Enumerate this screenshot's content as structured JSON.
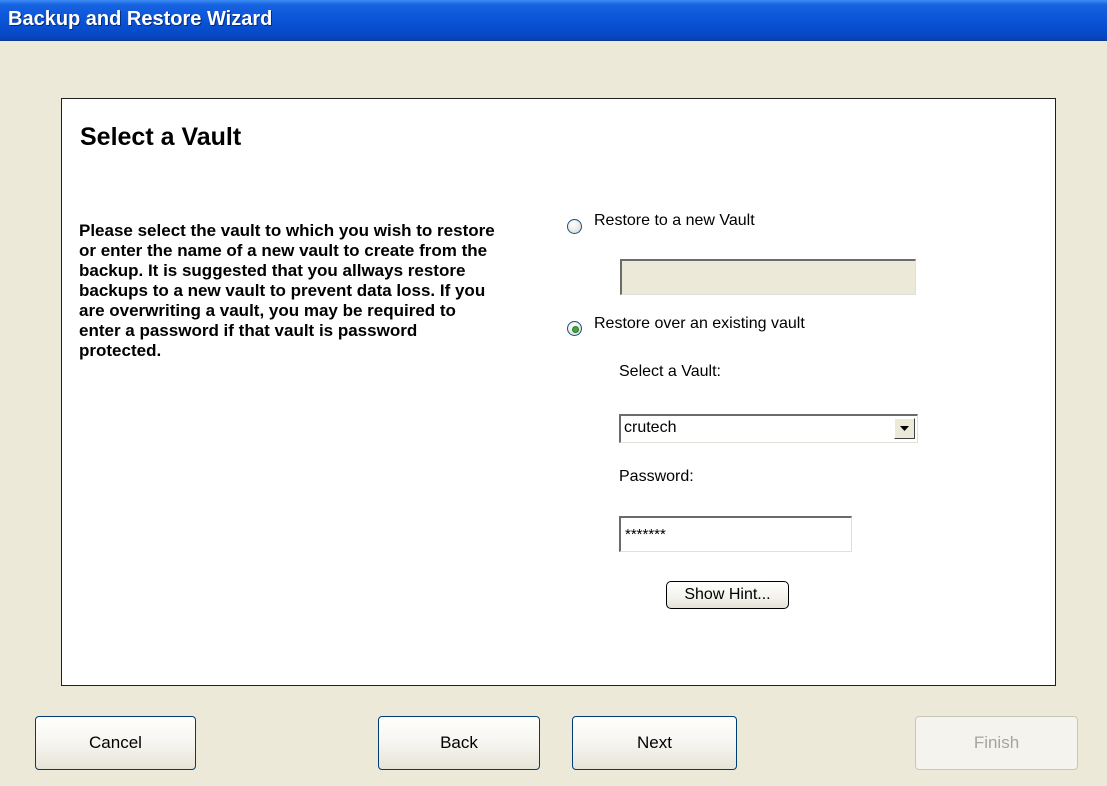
{
  "window": {
    "title": "Backup and Restore Wizard"
  },
  "page": {
    "heading": "Select a Vault",
    "description": "Please select the vault to which you wish to restore or enter the name of a new vault to create from the backup. It is suggested that you allways restore backups to a new vault to prevent data loss. If you are overwriting a vault, you may be required to enter a password if that vault is password protected."
  },
  "options": {
    "new_vault_label": "Restore to a new Vault",
    "new_vault_name": "",
    "existing_vault_label": "Restore over an existing vault",
    "selected": "existing"
  },
  "existing": {
    "select_label": "Select a Vault:",
    "selected_vault": "crutech",
    "password_label": "Password:",
    "password_value": "*******",
    "hint_button": "Show Hint..."
  },
  "footer": {
    "cancel": "Cancel",
    "back": "Back",
    "next": "Next",
    "finish": "Finish"
  }
}
